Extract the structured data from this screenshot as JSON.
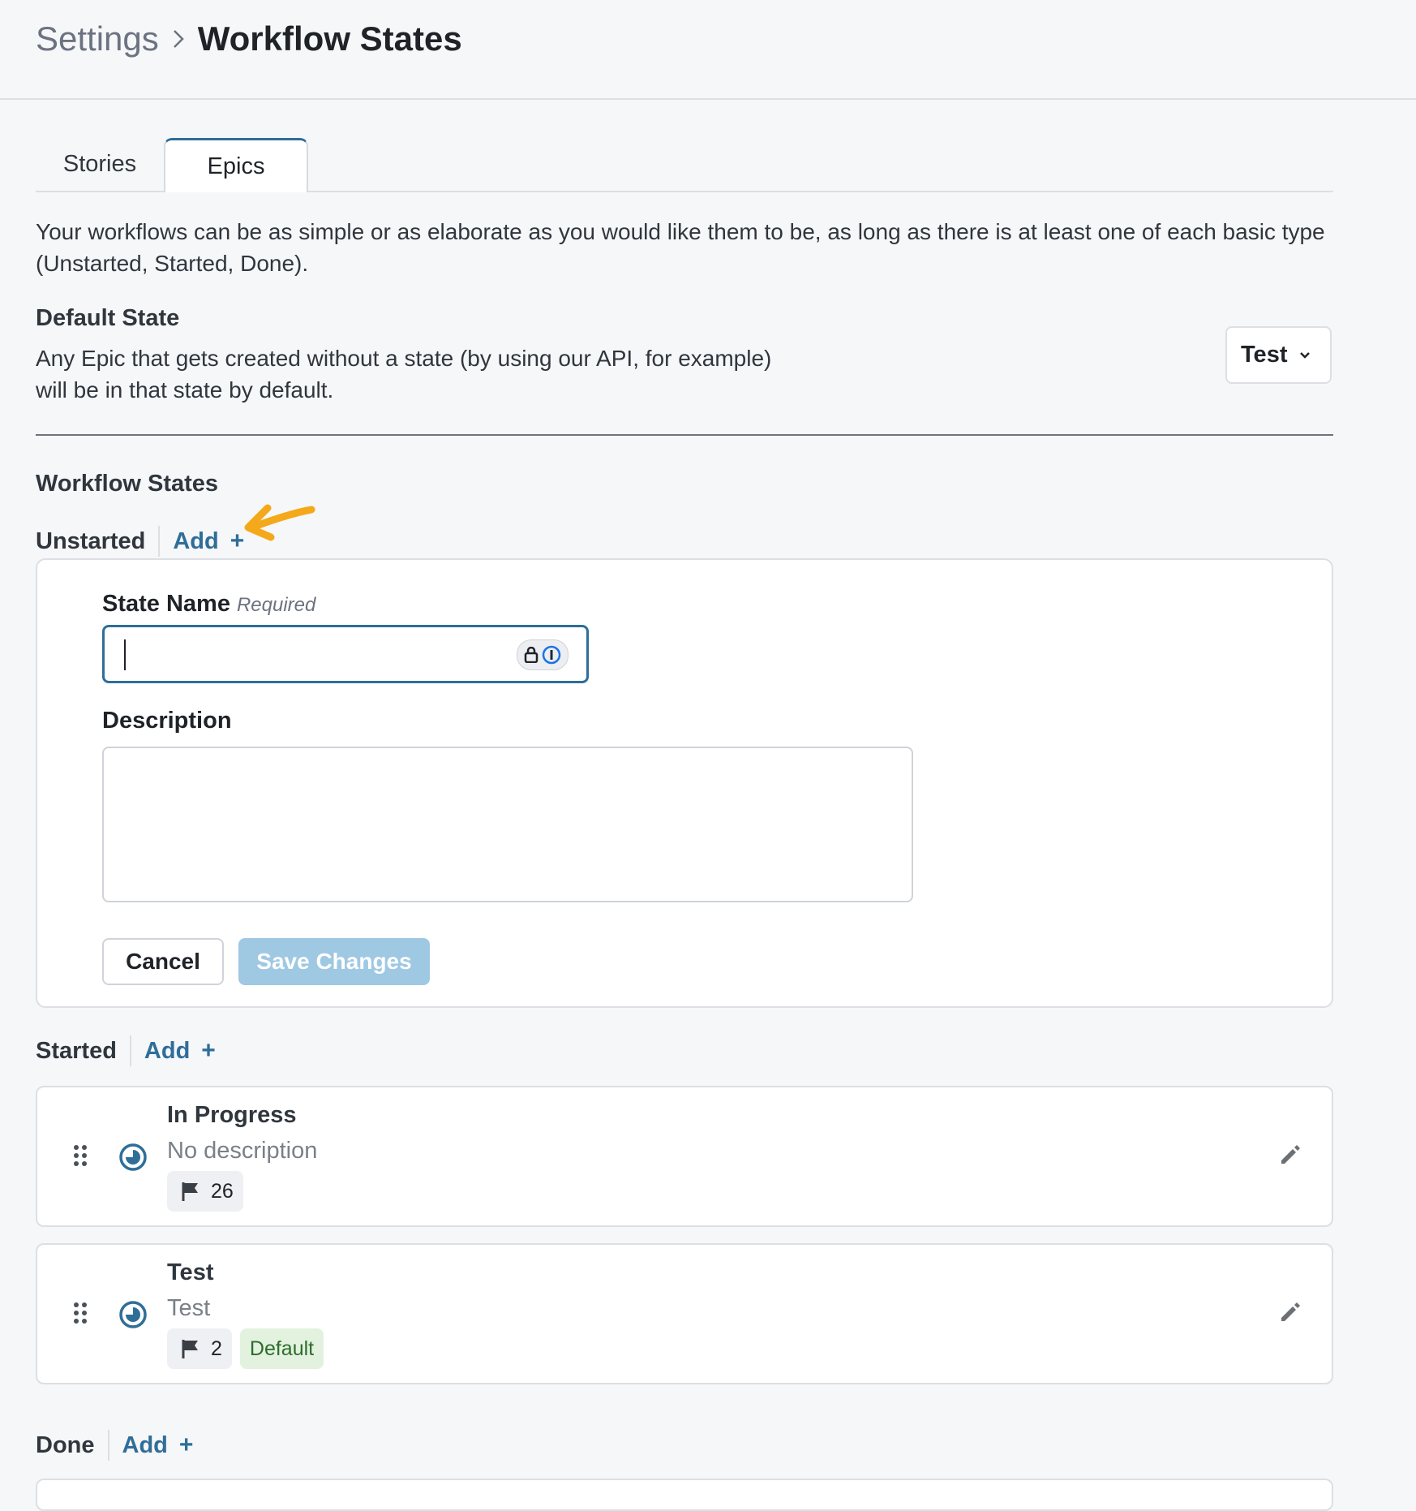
{
  "breadcrumb": {
    "parent": "Settings",
    "current": "Workflow States"
  },
  "tabs": [
    {
      "label": "Stories"
    },
    {
      "label": "Epics"
    }
  ],
  "intro_text": "Your workflows can be as simple or as elaborate as you would like them to be, as long as there is at least one of each basic type (Unstarted, Started, Done).",
  "default_state": {
    "title": "Default State",
    "description_line1": "Any Epic that gets created without a state (by using our API, for example)",
    "description_line2": "will be in that state by default.",
    "selected": "Test"
  },
  "workflow_states_title": "Workflow States",
  "groups": {
    "unstarted": {
      "label": "Unstarted",
      "add": "Add"
    },
    "started": {
      "label": "Started",
      "add": "Add"
    },
    "done": {
      "label": "Done",
      "add": "Add"
    }
  },
  "add_form": {
    "name_label": "State Name",
    "name_required": "Required",
    "name_value": "",
    "description_label": "Description",
    "description_value": "",
    "cancel": "Cancel",
    "save": "Save Changes"
  },
  "states": [
    {
      "name": "In Progress",
      "description": "No description",
      "count": "26"
    },
    {
      "name": "Test",
      "description": "Test",
      "count": "2",
      "badge": "Default"
    }
  ],
  "colors": {
    "accent": "#2f6e99",
    "save_disabled": "#9fc8e3",
    "default_badge_bg": "#e2f2df",
    "highlight_arrow": "#f4a91a"
  }
}
